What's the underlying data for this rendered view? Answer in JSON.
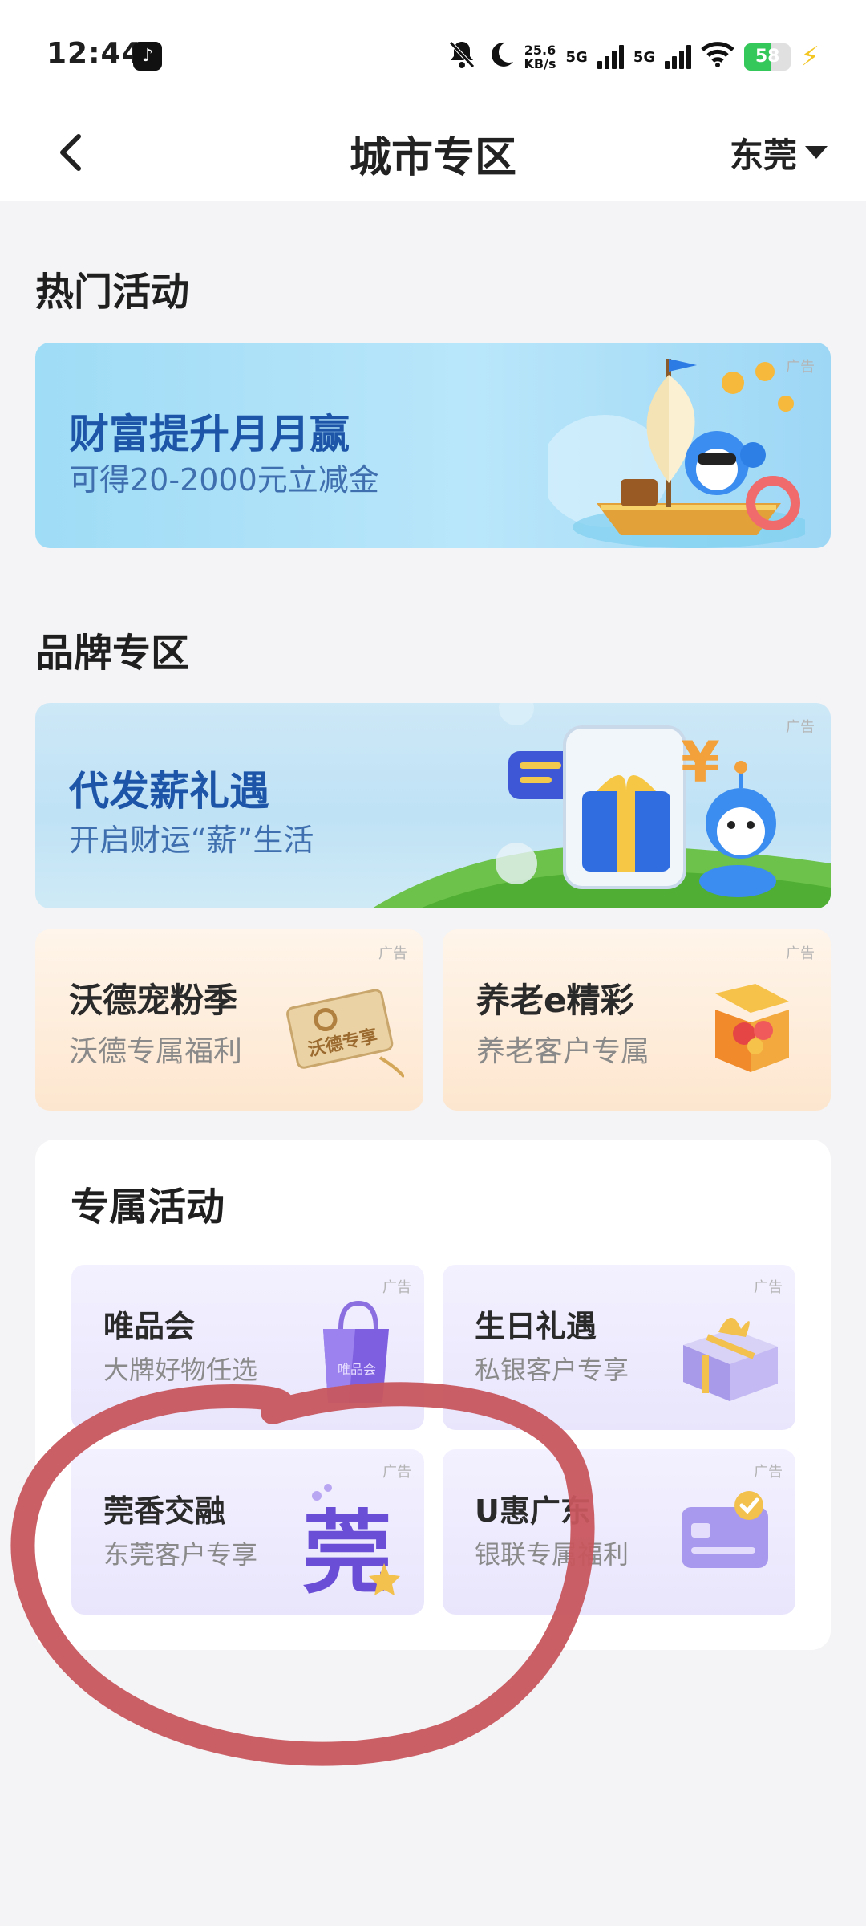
{
  "status_bar": {
    "time": "12:44",
    "net_speed_value": "25.6",
    "net_speed_unit": "KB/s",
    "network_1": "5G",
    "network_2": "5G",
    "battery": "58"
  },
  "header": {
    "title": "城市专区",
    "city": "东莞"
  },
  "hot_section": {
    "title": "热门活动",
    "banner": {
      "title": "财富提升月月赢",
      "subtitle": "可得20-2000元立减金",
      "ad": "广告"
    }
  },
  "brand_section": {
    "title": "品牌专区",
    "banner": {
      "title": "代发薪礼遇",
      "subtitle": "开启财运“薪”生活",
      "ad": "广告"
    },
    "cards": [
      {
        "title": "沃德宠粉季",
        "subtitle": "沃德专属福利",
        "ad": "广告",
        "art_text": "沃德专享"
      },
      {
        "title": "养老e精彩",
        "subtitle": "养老客户专属",
        "ad": "广告"
      }
    ]
  },
  "exclusive_section": {
    "title": "专属活动",
    "tiles": [
      {
        "title": "唯品会",
        "subtitle": "大牌好物任选",
        "ad": "广告",
        "art_text": "唯品会"
      },
      {
        "title": "生日礼遇",
        "subtitle": "私银客户专享",
        "ad": "广告"
      },
      {
        "title": "莞香交融",
        "subtitle": "东莞客户专享",
        "ad": "广告",
        "art_text": "莞"
      },
      {
        "title": "U惠广东",
        "subtitle": "银联专属福利",
        "ad": "广告"
      }
    ]
  },
  "colors": {
    "annotation_circle": "#c8565e",
    "banner_title": "#1d55a8",
    "tile_bg": "#ece8fd"
  }
}
